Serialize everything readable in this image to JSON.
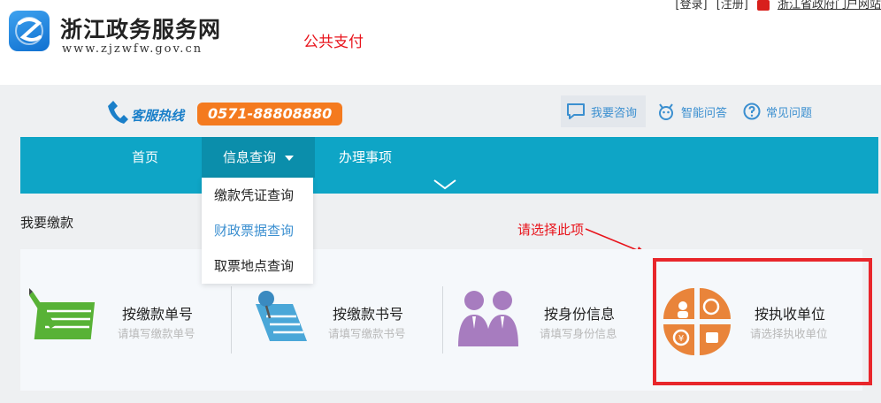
{
  "header": {
    "site_name": "浙江政务服务网",
    "site_url": "www.zjzwfw.gov.cn",
    "page_tag": "公共支付",
    "login": "[登录]",
    "register": "[注册]",
    "portal": "浙江省政府门户网站"
  },
  "hotline": {
    "label": "客服热线",
    "number": "0571-88808880"
  },
  "tools": [
    {
      "label": "我要咨询",
      "icon": "chat-bubble-icon"
    },
    {
      "label": "智能问答",
      "icon": "robot-icon"
    },
    {
      "label": "常见问题",
      "icon": "question-circle-icon"
    }
  ],
  "nav": {
    "home": "首页",
    "info": "信息查询",
    "do": "办理事项"
  },
  "dropdown": {
    "items": [
      "缴款凭证查询",
      "财政票据查询",
      "取票地点查询"
    ],
    "active_index": 1
  },
  "section_title": "我要缴款",
  "annotation": "请选择此项",
  "options": [
    {
      "title": "按缴款单号",
      "subtitle": "请填写缴款单号",
      "icon": "document-pen-icon"
    },
    {
      "title": "按缴款书号",
      "subtitle": "请填写缴款书号",
      "icon": "pinned-note-icon"
    },
    {
      "title": "按身份信息",
      "subtitle": "请填写身份信息",
      "icon": "people-icon"
    },
    {
      "title": "按执收单位",
      "subtitle": "请选择执收单位",
      "icon": "unit-circle-icon"
    }
  ],
  "colors": {
    "nav_bg": "#0ea5c6",
    "hotline_orange": "#f47a1f",
    "highlight_red": "#e8262b",
    "link_blue": "#3b8fd0"
  }
}
